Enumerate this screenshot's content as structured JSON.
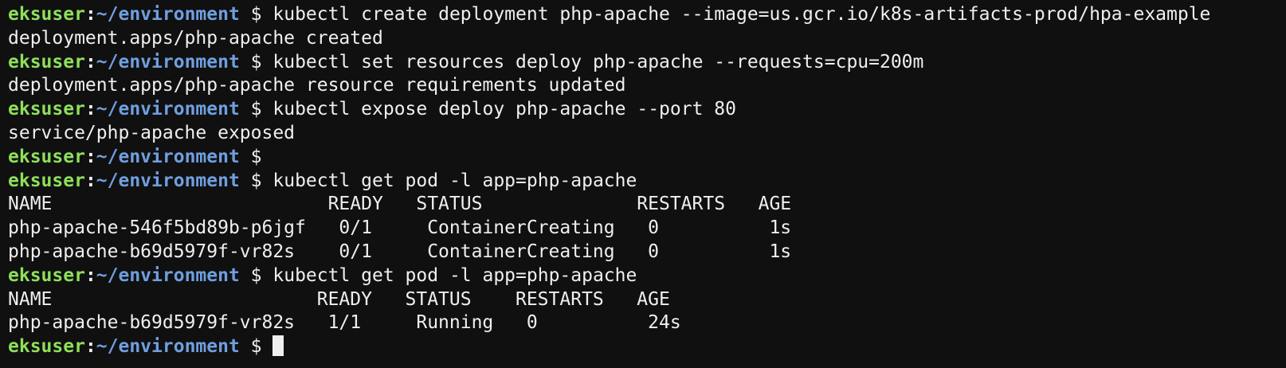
{
  "prompt": {
    "user": "eksuser",
    "separator": ":",
    "path": "~/environment",
    "symbol": "$"
  },
  "colors": {
    "background": "#101010",
    "user": "#8ee05a",
    "path": "#6f9fe0",
    "text": "#efefef"
  },
  "lines": [
    {
      "type": "prompt",
      "text": "kubectl create deployment php-apache --image=us.gcr.io/k8s-artifacts-prod/hpa-example"
    },
    {
      "type": "output",
      "text": "deployment.apps/php-apache created"
    },
    {
      "type": "prompt",
      "text": "kubectl set resources deploy php-apache --requests=cpu=200m"
    },
    {
      "type": "output",
      "text": "deployment.apps/php-apache resource requirements updated"
    },
    {
      "type": "prompt",
      "text": "kubectl expose deploy php-apache --port 80"
    },
    {
      "type": "output",
      "text": "service/php-apache exposed"
    },
    {
      "type": "prompt",
      "text": ""
    },
    {
      "type": "prompt",
      "text": "kubectl get pod -l app=php-apache"
    },
    {
      "type": "output",
      "text": "NAME                         READY   STATUS              RESTARTS   AGE"
    },
    {
      "type": "output",
      "text": "php-apache-546f5bd89b-p6jgf   0/1     ContainerCreating   0          1s"
    },
    {
      "type": "output",
      "text": "php-apache-b69d5979f-vr82s    0/1     ContainerCreating   0          1s"
    },
    {
      "type": "prompt",
      "text": "kubectl get pod -l app=php-apache"
    },
    {
      "type": "output",
      "text": "NAME                        READY   STATUS    RESTARTS   AGE"
    },
    {
      "type": "output",
      "text": "php-apache-b69d5979f-vr82s   1/1     Running   0          24s"
    },
    {
      "type": "prompt",
      "text": "",
      "cursor": true
    }
  ]
}
